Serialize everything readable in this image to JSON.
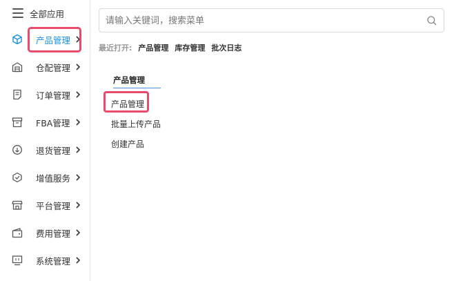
{
  "sidebar": {
    "header_title": "全部应用",
    "items": [
      {
        "label": "产品管理",
        "icon": "cube-icon",
        "active": true
      },
      {
        "label": "仓配管理",
        "icon": "warehouse-icon"
      },
      {
        "label": "订单管理",
        "icon": "document-icon"
      },
      {
        "label": "FBA管理",
        "icon": "box-icon"
      },
      {
        "label": "退货管理",
        "icon": "return-icon"
      },
      {
        "label": "增值服务",
        "icon": "value-added-icon"
      },
      {
        "label": "平台管理",
        "icon": "store-icon"
      },
      {
        "label": "费用管理",
        "icon": "wallet-icon"
      },
      {
        "label": "系统管理",
        "icon": "monitor-icon"
      }
    ]
  },
  "search": {
    "placeholder": "请输入关键词，搜索菜单",
    "value": ""
  },
  "recent": {
    "label": "最近打开:",
    "links": [
      "产品管理",
      "库存管理",
      "批次日志"
    ]
  },
  "section": {
    "title": "产品管理",
    "items": [
      "产品管理",
      "批量上传产品",
      "创建产品"
    ]
  },
  "colors": {
    "accent": "#1a8fe0",
    "highlight": "#ec4a6a",
    "underline": "#4a90e2"
  }
}
